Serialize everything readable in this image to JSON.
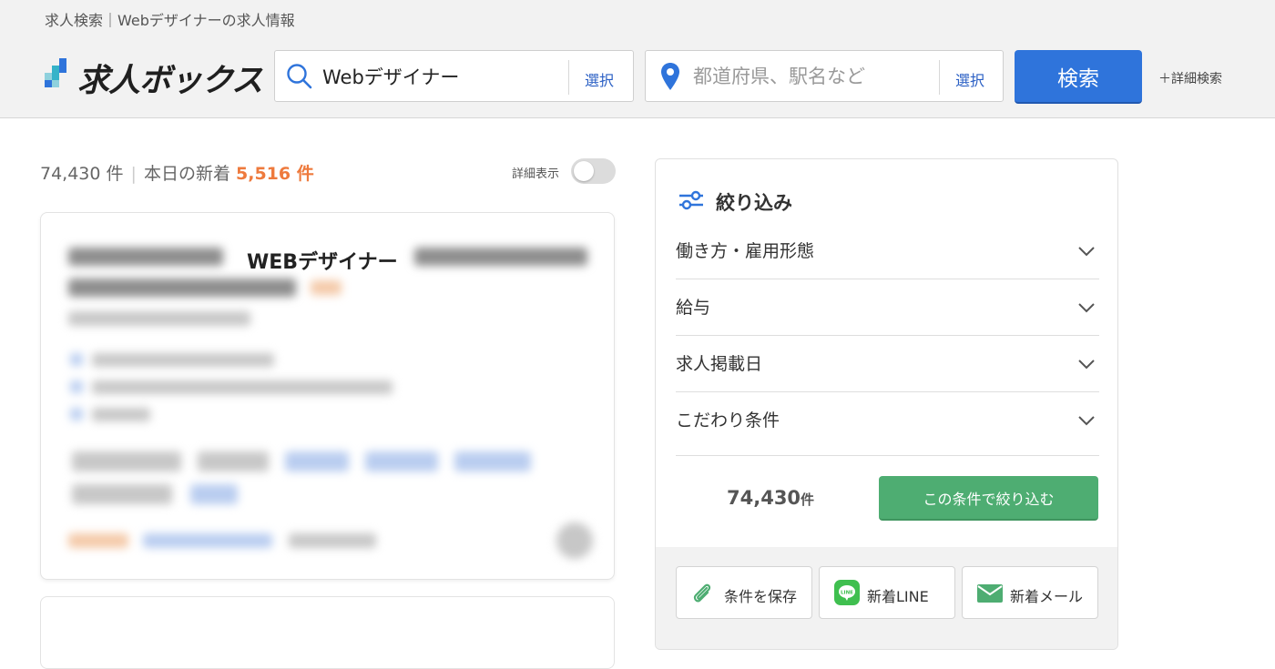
{
  "header": {
    "breadcrumb": "求人検索｜Webデザイナーの求人情報",
    "logo_text": "求人ボックス",
    "keyword": {
      "value": "Webデザイナー",
      "select_label": "選択"
    },
    "location": {
      "placeholder": "都道府県、駅名など",
      "select_label": "選択"
    },
    "search_button": "検索",
    "advanced_search": "＋詳細検索"
  },
  "results": {
    "total_label": "74,430 件",
    "today_prefix": "本日の新着",
    "today_count": "5,516 件",
    "detail_view_label": "詳細表示",
    "detail_view_on": false
  },
  "job_card": {
    "visible_title_fragment": "WEBデザイナー"
  },
  "filter_panel": {
    "title": "絞り込み",
    "rows": [
      {
        "label": "働き方・雇用形態"
      },
      {
        "label": "給与"
      },
      {
        "label": "求人掲載日"
      },
      {
        "label": "こだわり条件"
      }
    ],
    "result_count": "74,430",
    "result_unit": "件",
    "apply_button": "この条件で絞り込む",
    "footer_buttons": {
      "save": "条件を保存",
      "line": "新着LINE",
      "mail": "新着メール"
    }
  },
  "colors": {
    "primary_blue": "#2f74db",
    "accent_orange": "#ee7a3d",
    "apply_green": "#4ead72",
    "line_green": "#3fbf4f"
  }
}
